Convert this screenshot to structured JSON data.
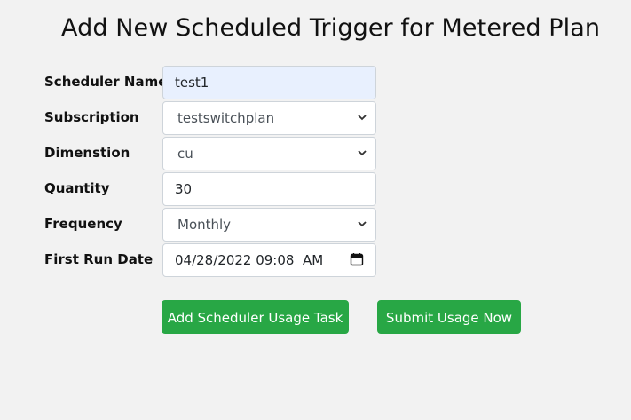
{
  "page": {
    "title": "Add New Scheduled Trigger for Metered Plan"
  },
  "form": {
    "scheduler_name": {
      "label": "Scheduler Name",
      "value": "test1"
    },
    "subscription": {
      "label": "Subscription",
      "value": "testswitchplan"
    },
    "dimension": {
      "label": "Dimenstion",
      "value": "cu"
    },
    "quantity": {
      "label": "Quantity",
      "value": "30"
    },
    "frequency": {
      "label": "Frequency",
      "value": "Monthly"
    },
    "first_run_date": {
      "label": "First Run Date",
      "value": "04/28/2022 09:08  AM"
    }
  },
  "actions": {
    "add_scheduler": "Add Scheduler Usage Task",
    "submit_usage": "Submit Usage Now"
  },
  "colors": {
    "background": "#f2f2f2",
    "button": "#28a745",
    "autofill": "#e8f0fe"
  },
  "icons": {
    "select_arrow": "chevron-down-icon",
    "date_picker": "calendar-icon"
  }
}
